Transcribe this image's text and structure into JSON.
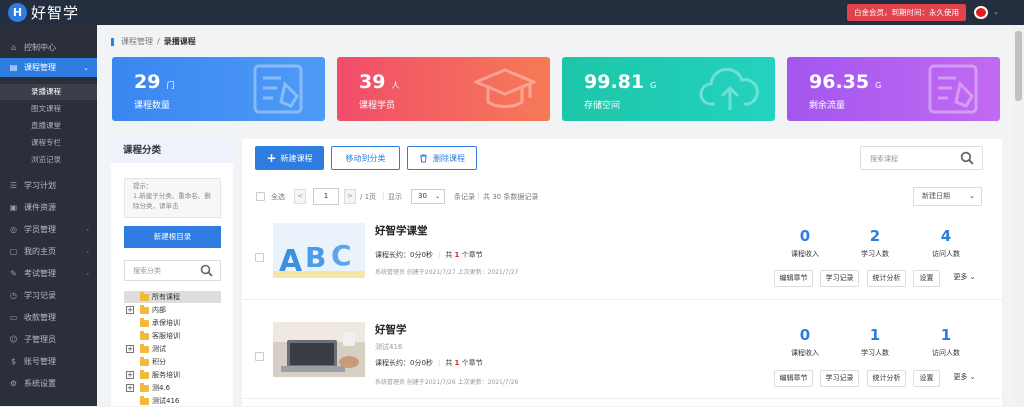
{
  "app": {
    "logo_letter": "H",
    "name": "好智学"
  },
  "header": {
    "membership": "白金会员，到期时间：永久使用"
  },
  "sidebar": {
    "items": [
      {
        "label": "控制中心",
        "icon": "home-icon"
      },
      {
        "label": "课程管理",
        "icon": "book-icon"
      },
      {
        "label": "学习计划",
        "icon": "plan-icon"
      },
      {
        "label": "课件资源",
        "icon": "resource-icon"
      },
      {
        "label": "学员管理",
        "icon": "users-icon"
      },
      {
        "label": "我的主页",
        "icon": "homepage-icon"
      },
      {
        "label": "考试管理",
        "icon": "exam-icon"
      },
      {
        "label": "学习记录",
        "icon": "record-icon"
      },
      {
        "label": "收款管理",
        "icon": "payment-icon"
      },
      {
        "label": "子管理员",
        "icon": "admin-icon"
      },
      {
        "label": "账号管理",
        "icon": "account-icon"
      },
      {
        "label": "系统设置",
        "icon": "settings-icon"
      }
    ],
    "sub_items": [
      {
        "label": "录播课程"
      },
      {
        "label": "图文课程"
      },
      {
        "label": "直播课堂"
      },
      {
        "label": "课程专栏"
      },
      {
        "label": "浏览记录"
      }
    ]
  },
  "breadcrumb": {
    "parent": "课程管理",
    "sep": "/",
    "current": "录播课程"
  },
  "stats": [
    {
      "value": "29",
      "unit": "门",
      "label": "课程数量",
      "color": "#3d8bf2"
    },
    {
      "value": "39",
      "unit": "人",
      "label": "课程学员",
      "color": "#f25a6e"
    },
    {
      "value": "99.81",
      "unit": "G",
      "label": "存储空间",
      "color": "#1ec9b0"
    },
    {
      "value": "96.35",
      "unit": "G",
      "label": "剩余流量",
      "color": "#b05df0"
    }
  ],
  "category": {
    "title": "课程分类",
    "tip_line1": "提示：",
    "tip_line2": "1.新建子分类、重命名、删除分类，请单击",
    "new_dir_button": "新建根目录",
    "search_placeholder": "搜索分类",
    "tree": [
      {
        "label": "所有课程",
        "expander": ""
      },
      {
        "label": "内部",
        "expander": "+"
      },
      {
        "label": "承保培训",
        "expander": ""
      },
      {
        "label": "客服培训",
        "expander": ""
      },
      {
        "label": "测试",
        "expander": "+"
      },
      {
        "label": "积分",
        "expander": ""
      },
      {
        "label": "服务培训",
        "expander": "+"
      },
      {
        "label": "测4.6",
        "expander": "+"
      },
      {
        "label": "测试416",
        "expander": ""
      }
    ]
  },
  "toolbar": {
    "new_course": "新建课程",
    "move_category": "移动到分类",
    "delete_course": "删除课程",
    "search_placeholder": "搜索课程"
  },
  "list_bar": {
    "select_all": "全选",
    "prev": "<",
    "page": "1",
    "next": ">",
    "total_pages": "/ 1页",
    "display": "显示",
    "page_size": "30",
    "per_page_suffix": "条记录",
    "total": "共 30 条数据记录",
    "sort": "新建日期"
  },
  "courses": [
    {
      "title": "好智学课堂",
      "subtitle": "",
      "duration_label": "课程长约：0分0秒",
      "chapters_prefix": "共",
      "chapters_count": "1",
      "chapters_suffix": "个章节",
      "info": "系统管理员 创建于2021/7/27 上次更新：2021/7/27",
      "revenue": "0",
      "revenue_label": "课程收入",
      "learners": "2",
      "learners_label": "学习人数",
      "visitors": "4",
      "visitors_label": "访问人数",
      "actions": [
        "编辑章节",
        "学习记录",
        "统计分析",
        "设置",
        "更多"
      ]
    },
    {
      "title": "好智学",
      "subtitle": "测试416",
      "duration_label": "课程长约：0分0秒",
      "chapters_prefix": "共",
      "chapters_count": "1",
      "chapters_suffix": "个章节",
      "info": "系统管理员 创建于2021/7/26 上次更新：2021/7/26",
      "revenue": "0",
      "revenue_label": "课程收入",
      "learners": "1",
      "learners_label": "学习人数",
      "visitors": "1",
      "visitors_label": "访问人数",
      "actions": [
        "编辑章节",
        "学习记录",
        "统计分析",
        "设置",
        "更多"
      ]
    }
  ],
  "colors": {
    "primary": "#2f7de1",
    "sidebar": "#2b2f3a",
    "topbar": "#232f3e",
    "danger": "#e02020"
  }
}
